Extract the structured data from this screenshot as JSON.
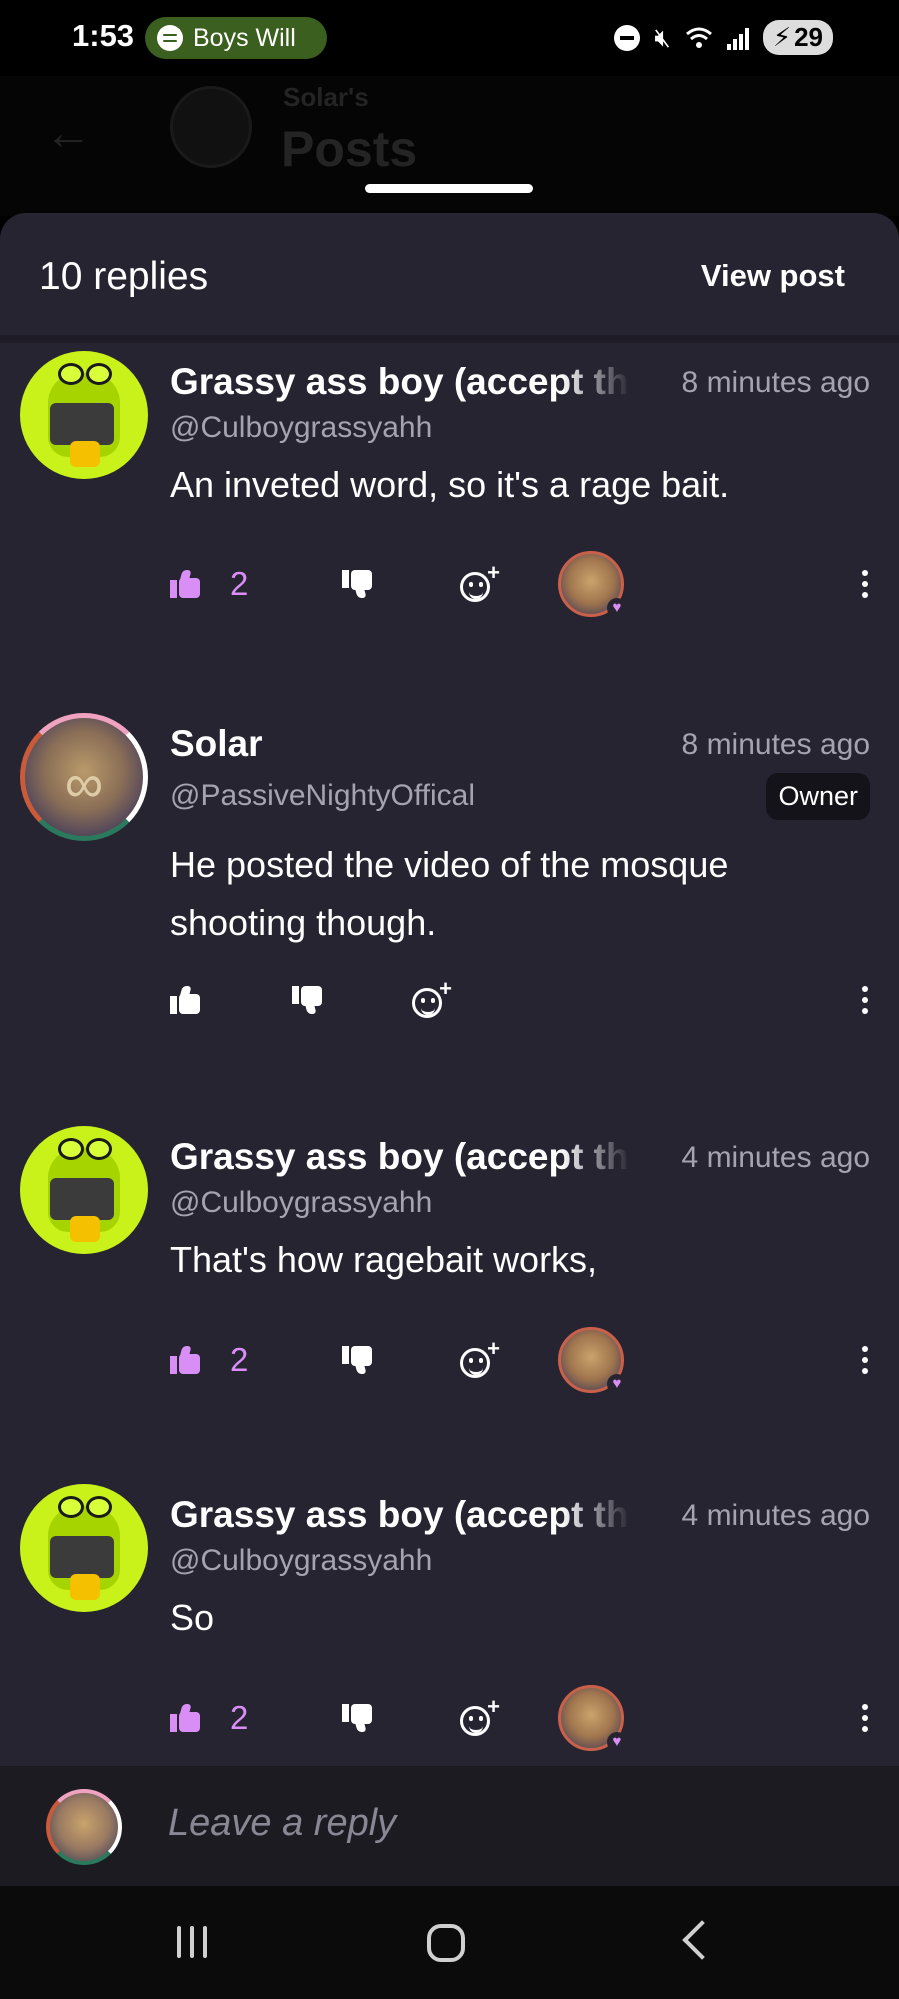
{
  "status_bar": {
    "time": "1:53",
    "media_label": "Boys Will",
    "battery": "29"
  },
  "background_header": {
    "subtitle": "Solar's",
    "title": "Posts"
  },
  "sheet": {
    "replies_count": "10 replies",
    "view_post_label": "View post"
  },
  "comments": [
    {
      "name": "Grassy ass boy (accept the",
      "handle": "@Culboygrassyahh",
      "time": "8 minutes ago",
      "text": "An inveted word, so it's a rage bait.",
      "likes": "2",
      "liked": true
    },
    {
      "name": "Solar",
      "handle": "@PassiveNightyOffical",
      "time": "8 minutes ago",
      "badge": "Owner",
      "text": "He posted the video of the mosque shooting though.",
      "likes": "",
      "liked": false
    },
    {
      "name": "Grassy ass boy (accept the",
      "handle": "@Culboygrassyahh",
      "time": "4 minutes ago",
      "text": "That's how ragebait works,",
      "likes": "2",
      "liked": true
    },
    {
      "name": "Grassy ass boy (accept the",
      "handle": "@Culboygrassyahh",
      "time": "4 minutes ago",
      "text": "So",
      "likes": "2",
      "liked": true
    }
  ],
  "reply_bar": {
    "placeholder": "Leave a reply"
  },
  "colors": {
    "sheet_bg": "#272432",
    "accent_purple": "#d98ef5",
    "muted_text": "#a6a3b0"
  }
}
